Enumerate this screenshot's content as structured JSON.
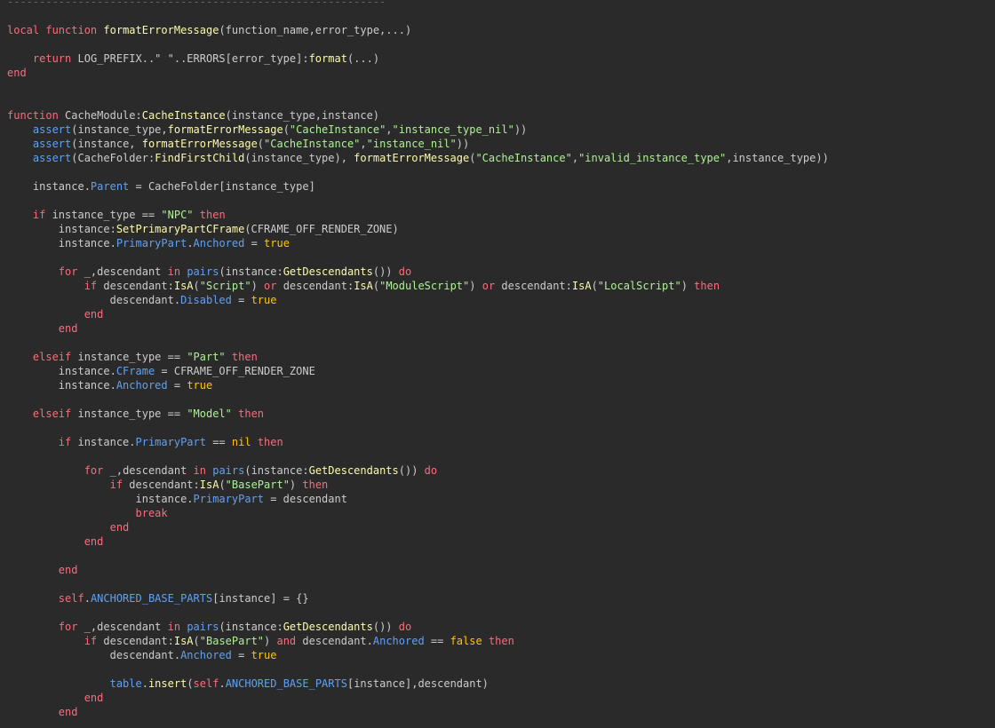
{
  "editor": {
    "name": "script-editor",
    "colors": {
      "background": "#2a2a2a",
      "keyword": "#f86d7c",
      "function": "#fdfbac",
      "string": "#adf195",
      "property": "#61a1f1",
      "text": "#cccccc",
      "boolean": "#ffc600",
      "comment": "#666666"
    },
    "lines": [
      [
        [
          "cm",
          "-----------------------------------------------------------"
        ]
      ],
      [],
      [
        [
          "kw",
          "local"
        ],
        [
          "id",
          " "
        ],
        [
          "kw",
          "function"
        ],
        [
          "id",
          " "
        ],
        [
          "fn",
          "formatErrorMessage"
        ],
        [
          "id",
          "(function_name,error_type,...)"
        ]
      ],
      [],
      [
        [
          "id",
          "    "
        ],
        [
          "kw",
          "return"
        ],
        [
          "id",
          " LOG_PREFIX..\" \"..ERRORS[error_type]:"
        ],
        [
          "fn",
          "format"
        ],
        [
          "id",
          "(...)"
        ]
      ],
      [
        [
          "kw",
          "end"
        ]
      ],
      [],
      [],
      [
        [
          "kw",
          "function"
        ],
        [
          "id",
          " CacheModule:"
        ],
        [
          "fn",
          "CacheInstance"
        ],
        [
          "id",
          "(instance_type,instance)"
        ]
      ],
      [
        [
          "id",
          "    "
        ],
        [
          "prop",
          "assert"
        ],
        [
          "id",
          "(instance_type,"
        ],
        [
          "fn",
          "formatErrorMessage"
        ],
        [
          "id",
          "("
        ],
        [
          "str",
          "\"CacheInstance\""
        ],
        [
          "id",
          ","
        ],
        [
          "str",
          "\"instance_type_nil\""
        ],
        [
          "id",
          "))"
        ]
      ],
      [
        [
          "id",
          "    "
        ],
        [
          "prop",
          "assert"
        ],
        [
          "id",
          "(instance, "
        ],
        [
          "fn",
          "formatErrorMessage"
        ],
        [
          "id",
          "("
        ],
        [
          "str",
          "\"CacheInstance\""
        ],
        [
          "id",
          ","
        ],
        [
          "str",
          "\"instance_nil\""
        ],
        [
          "id",
          "))"
        ]
      ],
      [
        [
          "id",
          "    "
        ],
        [
          "prop",
          "assert"
        ],
        [
          "id",
          "(CacheFolder:"
        ],
        [
          "fn",
          "FindFirstChild"
        ],
        [
          "id",
          "(instance_type), "
        ],
        [
          "fn",
          "formatErrorMessage"
        ],
        [
          "id",
          "("
        ],
        [
          "str",
          "\"CacheInstance\""
        ],
        [
          "id",
          ","
        ],
        [
          "str",
          "\"invalid_instance_type\""
        ],
        [
          "id",
          ",instance_type))"
        ]
      ],
      [],
      [
        [
          "id",
          "    instance."
        ],
        [
          "prop",
          "Parent"
        ],
        [
          "id",
          " = CacheFolder[instance_type]"
        ]
      ],
      [],
      [
        [
          "id",
          "    "
        ],
        [
          "kw",
          "if"
        ],
        [
          "id",
          " instance_type == "
        ],
        [
          "str",
          "\"NPC\""
        ],
        [
          "id",
          " "
        ],
        [
          "kw",
          "then"
        ]
      ],
      [
        [
          "id",
          "        instance:"
        ],
        [
          "fn",
          "SetPrimaryPartCFrame"
        ],
        [
          "id",
          "(CFRAME_OFF_RENDER_ZONE)"
        ]
      ],
      [
        [
          "id",
          "        instance."
        ],
        [
          "prop",
          "PrimaryPart"
        ],
        [
          "id",
          "."
        ],
        [
          "prop",
          "Anchored"
        ],
        [
          "id",
          " = "
        ],
        [
          "bool",
          "true"
        ]
      ],
      [],
      [
        [
          "id",
          "        "
        ],
        [
          "kw",
          "for"
        ],
        [
          "id",
          " _,descendant "
        ],
        [
          "kw",
          "in"
        ],
        [
          "id",
          " "
        ],
        [
          "prop",
          "pairs"
        ],
        [
          "id",
          "(instance:"
        ],
        [
          "fn",
          "GetDescendants"
        ],
        [
          "id",
          "()) "
        ],
        [
          "kw",
          "do"
        ]
      ],
      [
        [
          "id",
          "            "
        ],
        [
          "kw",
          "if"
        ],
        [
          "id",
          " descendant:"
        ],
        [
          "fn",
          "IsA"
        ],
        [
          "id",
          "("
        ],
        [
          "str",
          "\"Script\""
        ],
        [
          "id",
          ") "
        ],
        [
          "kw",
          "or"
        ],
        [
          "id",
          " descendant:"
        ],
        [
          "fn",
          "IsA"
        ],
        [
          "id",
          "("
        ],
        [
          "str",
          "\"ModuleScript\""
        ],
        [
          "id",
          ") "
        ],
        [
          "kw",
          "or"
        ],
        [
          "id",
          " descendant:"
        ],
        [
          "fn",
          "IsA"
        ],
        [
          "id",
          "("
        ],
        [
          "str",
          "\"LocalScript\""
        ],
        [
          "id",
          ") "
        ],
        [
          "kw",
          "then"
        ]
      ],
      [
        [
          "id",
          "                descendant."
        ],
        [
          "prop",
          "Disabled"
        ],
        [
          "id",
          " = "
        ],
        [
          "bool",
          "true"
        ]
      ],
      [
        [
          "id",
          "            "
        ],
        [
          "kw",
          "end"
        ]
      ],
      [
        [
          "id",
          "        "
        ],
        [
          "kw",
          "end"
        ]
      ],
      [],
      [
        [
          "id",
          "    "
        ],
        [
          "kw",
          "elseif"
        ],
        [
          "id",
          " instance_type == "
        ],
        [
          "str",
          "\"Part\""
        ],
        [
          "id",
          " "
        ],
        [
          "kw",
          "then"
        ]
      ],
      [
        [
          "id",
          "        instance."
        ],
        [
          "prop",
          "CFrame"
        ],
        [
          "id",
          " = CFRAME_OFF_RENDER_ZONE"
        ]
      ],
      [
        [
          "id",
          "        instance."
        ],
        [
          "prop",
          "Anchored"
        ],
        [
          "id",
          " = "
        ],
        [
          "bool",
          "true"
        ]
      ],
      [],
      [
        [
          "id",
          "    "
        ],
        [
          "kw",
          "elseif"
        ],
        [
          "id",
          " instance_type == "
        ],
        [
          "str",
          "\"Model\""
        ],
        [
          "id",
          " "
        ],
        [
          "kw",
          "then"
        ]
      ],
      [],
      [
        [
          "id",
          "        "
        ],
        [
          "kw",
          "if"
        ],
        [
          "id",
          " instance."
        ],
        [
          "prop",
          "PrimaryPart"
        ],
        [
          "id",
          " == "
        ],
        [
          "bool",
          "nil"
        ],
        [
          "id",
          " "
        ],
        [
          "kw",
          "then"
        ]
      ],
      [],
      [
        [
          "id",
          "            "
        ],
        [
          "kw",
          "for"
        ],
        [
          "id",
          " _,descendant "
        ],
        [
          "kw",
          "in"
        ],
        [
          "id",
          " "
        ],
        [
          "prop",
          "pairs"
        ],
        [
          "id",
          "(instance:"
        ],
        [
          "fn",
          "GetDescendants"
        ],
        [
          "id",
          "()) "
        ],
        [
          "kw",
          "do"
        ]
      ],
      [
        [
          "id",
          "                "
        ],
        [
          "kw",
          "if"
        ],
        [
          "id",
          " descendant:"
        ],
        [
          "fn",
          "IsA"
        ],
        [
          "id",
          "("
        ],
        [
          "str",
          "\"BasePart\""
        ],
        [
          "id",
          ") "
        ],
        [
          "kw",
          "then"
        ]
      ],
      [
        [
          "id",
          "                    instance."
        ],
        [
          "prop",
          "PrimaryPart"
        ],
        [
          "id",
          " = descendant"
        ]
      ],
      [
        [
          "id",
          "                    "
        ],
        [
          "kw",
          "break"
        ]
      ],
      [
        [
          "id",
          "                "
        ],
        [
          "kw",
          "end"
        ]
      ],
      [
        [
          "id",
          "            "
        ],
        [
          "kw",
          "end"
        ]
      ],
      [],
      [
        [
          "id",
          "        "
        ],
        [
          "kw",
          "end"
        ]
      ],
      [],
      [
        [
          "id",
          "        "
        ],
        [
          "kw",
          "self"
        ],
        [
          "id",
          "."
        ],
        [
          "prop",
          "ANCHORED_BASE_PARTS"
        ],
        [
          "id",
          "[instance] = {}"
        ]
      ],
      [],
      [
        [
          "id",
          "        "
        ],
        [
          "kw",
          "for"
        ],
        [
          "id",
          " _,descendant "
        ],
        [
          "kw",
          "in"
        ],
        [
          "id",
          " "
        ],
        [
          "prop",
          "pairs"
        ],
        [
          "id",
          "(instance:"
        ],
        [
          "fn",
          "GetDescendants"
        ],
        [
          "id",
          "()) "
        ],
        [
          "kw",
          "do"
        ]
      ],
      [
        [
          "id",
          "            "
        ],
        [
          "kw",
          "if"
        ],
        [
          "id",
          " descendant:"
        ],
        [
          "fn",
          "IsA"
        ],
        [
          "id",
          "("
        ],
        [
          "str",
          "\"BasePart\""
        ],
        [
          "id",
          ") "
        ],
        [
          "kw",
          "and"
        ],
        [
          "id",
          " descendant."
        ],
        [
          "prop",
          "Anchored"
        ],
        [
          "id",
          " == "
        ],
        [
          "bool",
          "false"
        ],
        [
          "id",
          " "
        ],
        [
          "kw",
          "then"
        ]
      ],
      [
        [
          "id",
          "                descendant."
        ],
        [
          "prop",
          "Anchored"
        ],
        [
          "id",
          " = "
        ],
        [
          "bool",
          "true"
        ]
      ],
      [],
      [
        [
          "id",
          "                "
        ],
        [
          "prop",
          "table"
        ],
        [
          "id",
          "."
        ],
        [
          "fn",
          "insert"
        ],
        [
          "id",
          "("
        ],
        [
          "kw",
          "self"
        ],
        [
          "id",
          "."
        ],
        [
          "prop",
          "ANCHORED_BASE_PARTS"
        ],
        [
          "id",
          "[instance],descendant)"
        ]
      ],
      [
        [
          "id",
          "            "
        ],
        [
          "kw",
          "end"
        ]
      ],
      [
        [
          "id",
          "        "
        ],
        [
          "kw",
          "end"
        ]
      ]
    ]
  }
}
